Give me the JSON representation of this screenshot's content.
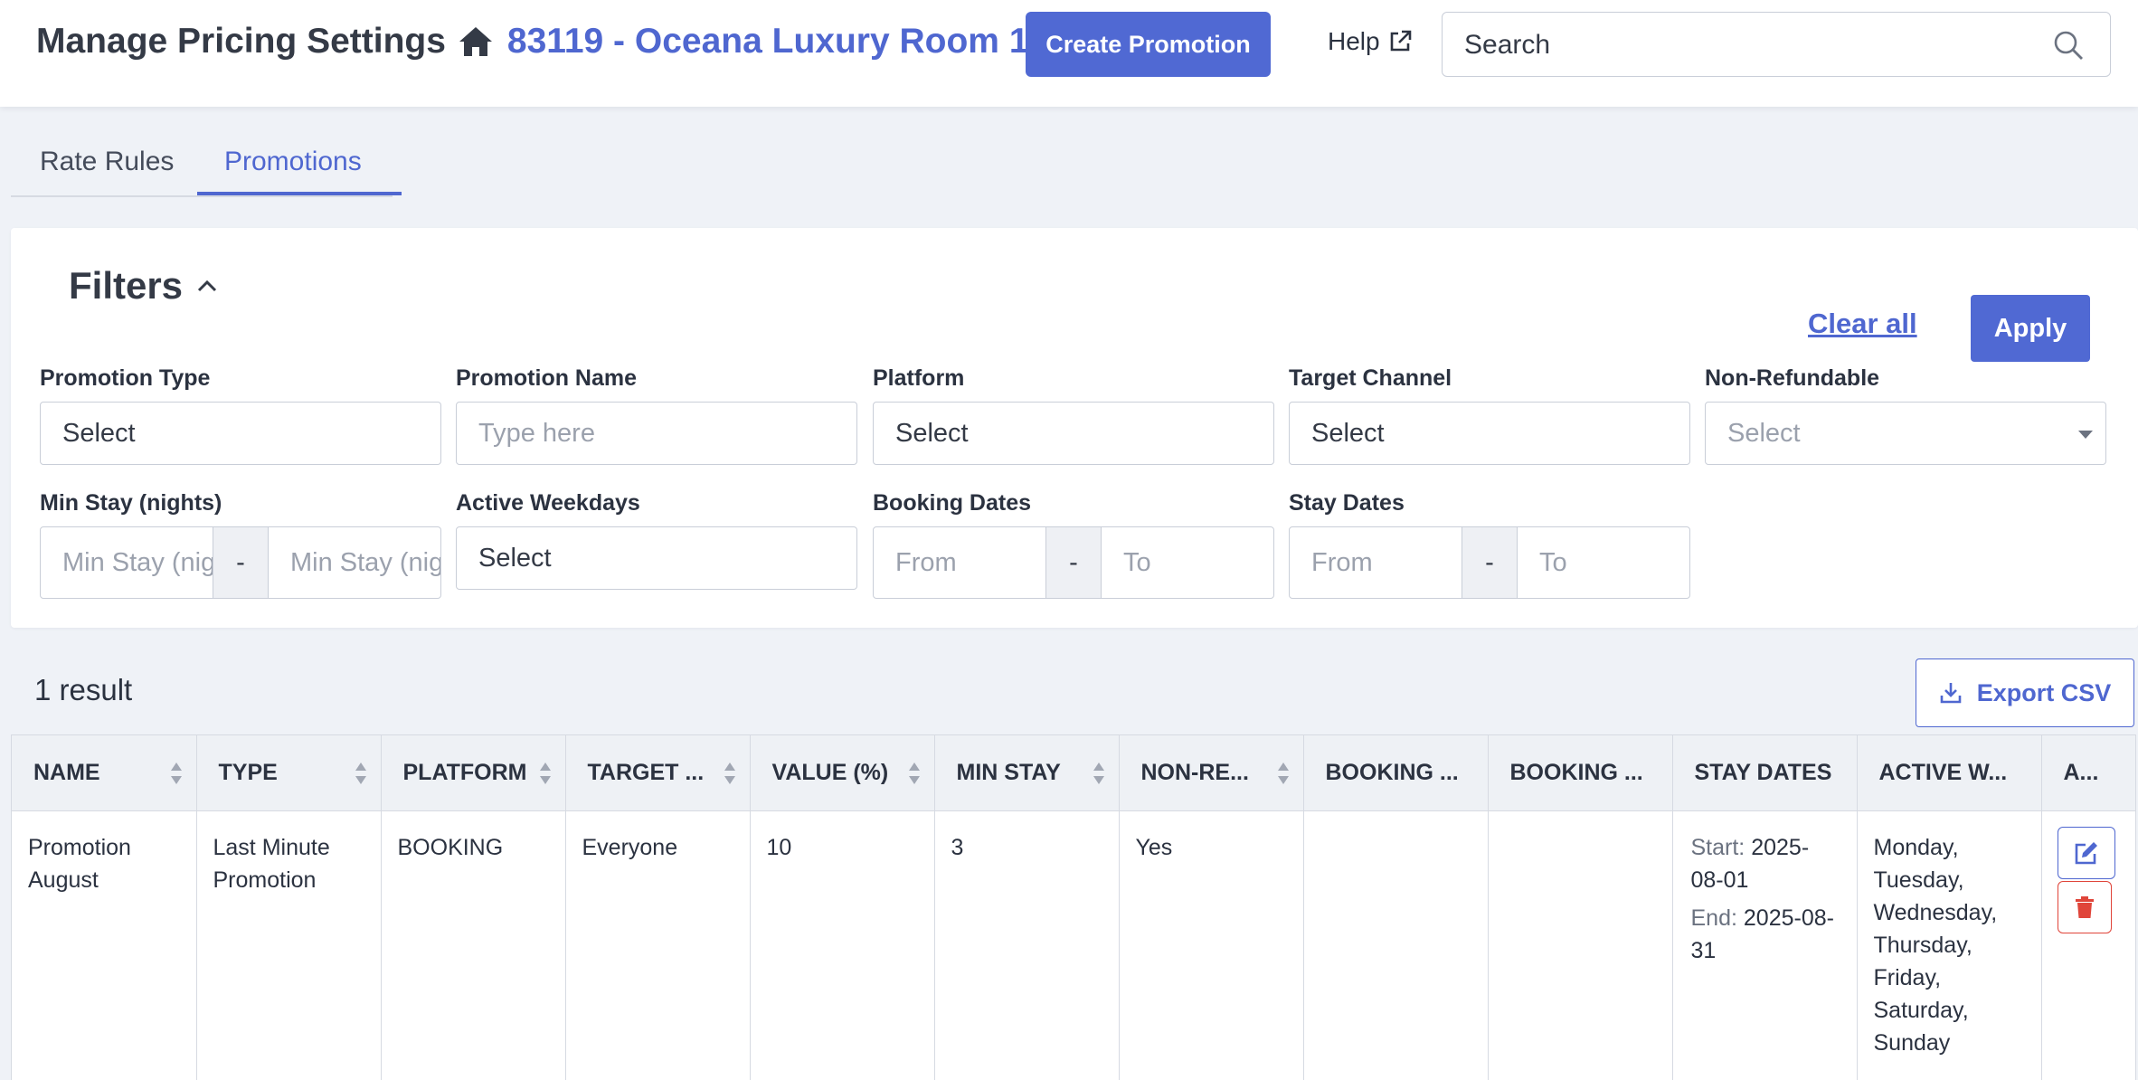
{
  "header": {
    "title": "Manage Pricing Settings",
    "property_link": "83119 - Oceana Luxury Room 1",
    "create_button": "Create Promotion",
    "help_label": "Help",
    "search_placeholder": "Search"
  },
  "tabs": [
    {
      "label": "Rate Rules",
      "active": false
    },
    {
      "label": "Promotions",
      "active": true
    }
  ],
  "filters": {
    "title": "Filters",
    "promotion_type": {
      "label": "Promotion Type",
      "value": "Select"
    },
    "promotion_name": {
      "label": "Promotion Name",
      "placeholder": "Type here"
    },
    "platform": {
      "label": "Platform",
      "value": "Select"
    },
    "target_channel": {
      "label": "Target Channel",
      "value": "Select"
    },
    "non_refundable": {
      "label": "Non-Refundable",
      "value": "Select"
    },
    "min_stay": {
      "label": "Min Stay (nights)",
      "from_placeholder": "Min Stay (nights)",
      "to_placeholder": "Min Stay (nights)",
      "separator": "-"
    },
    "active_weekdays": {
      "label": "Active Weekdays",
      "value": "Select"
    },
    "booking_dates": {
      "label": "Booking Dates",
      "from_placeholder": "From",
      "to_placeholder": "To",
      "separator": "-"
    },
    "stay_dates": {
      "label": "Stay Dates",
      "from_placeholder": "From",
      "to_placeholder": "To",
      "separator": "-"
    },
    "clear_all": "Clear all",
    "apply": "Apply"
  },
  "results": {
    "count_label": "1 result",
    "export_button": "Export CSV"
  },
  "table": {
    "columns": [
      "NAME",
      "TYPE",
      "PLATFORM",
      "TARGET ...",
      "VALUE (%)",
      "MIN STAY",
      "NON-RE...",
      "BOOKING ...",
      "BOOKING ...",
      "STAY DATES",
      "ACTIVE W...",
      "A..."
    ],
    "rows": [
      {
        "name": "Promotion August",
        "type": "Last Minute Promotion",
        "platform": "BOOKING",
        "target": "Everyone",
        "value": "10",
        "min_stay": "3",
        "non_refundable": "Yes",
        "booking_start": "",
        "booking_end": "",
        "stay_start_key": "Start:",
        "stay_start": "2025-08-01",
        "stay_end_key": "End:",
        "stay_end": "2025-08-31",
        "active_weekdays": "Monday, Tuesday, Wednesday, Thursday, Friday, Saturday, Sunday"
      }
    ]
  },
  "colors": {
    "accent": "#5069d3",
    "link": "#4f67d0",
    "danger": "#e0453a",
    "page_bg": "#eff2f7"
  },
  "icons": [
    "home-icon",
    "external-link-icon",
    "search-icon",
    "chevron-up-icon",
    "caret-down-icon",
    "download-icon",
    "sort-icon",
    "edit-icon",
    "trash-icon"
  ]
}
